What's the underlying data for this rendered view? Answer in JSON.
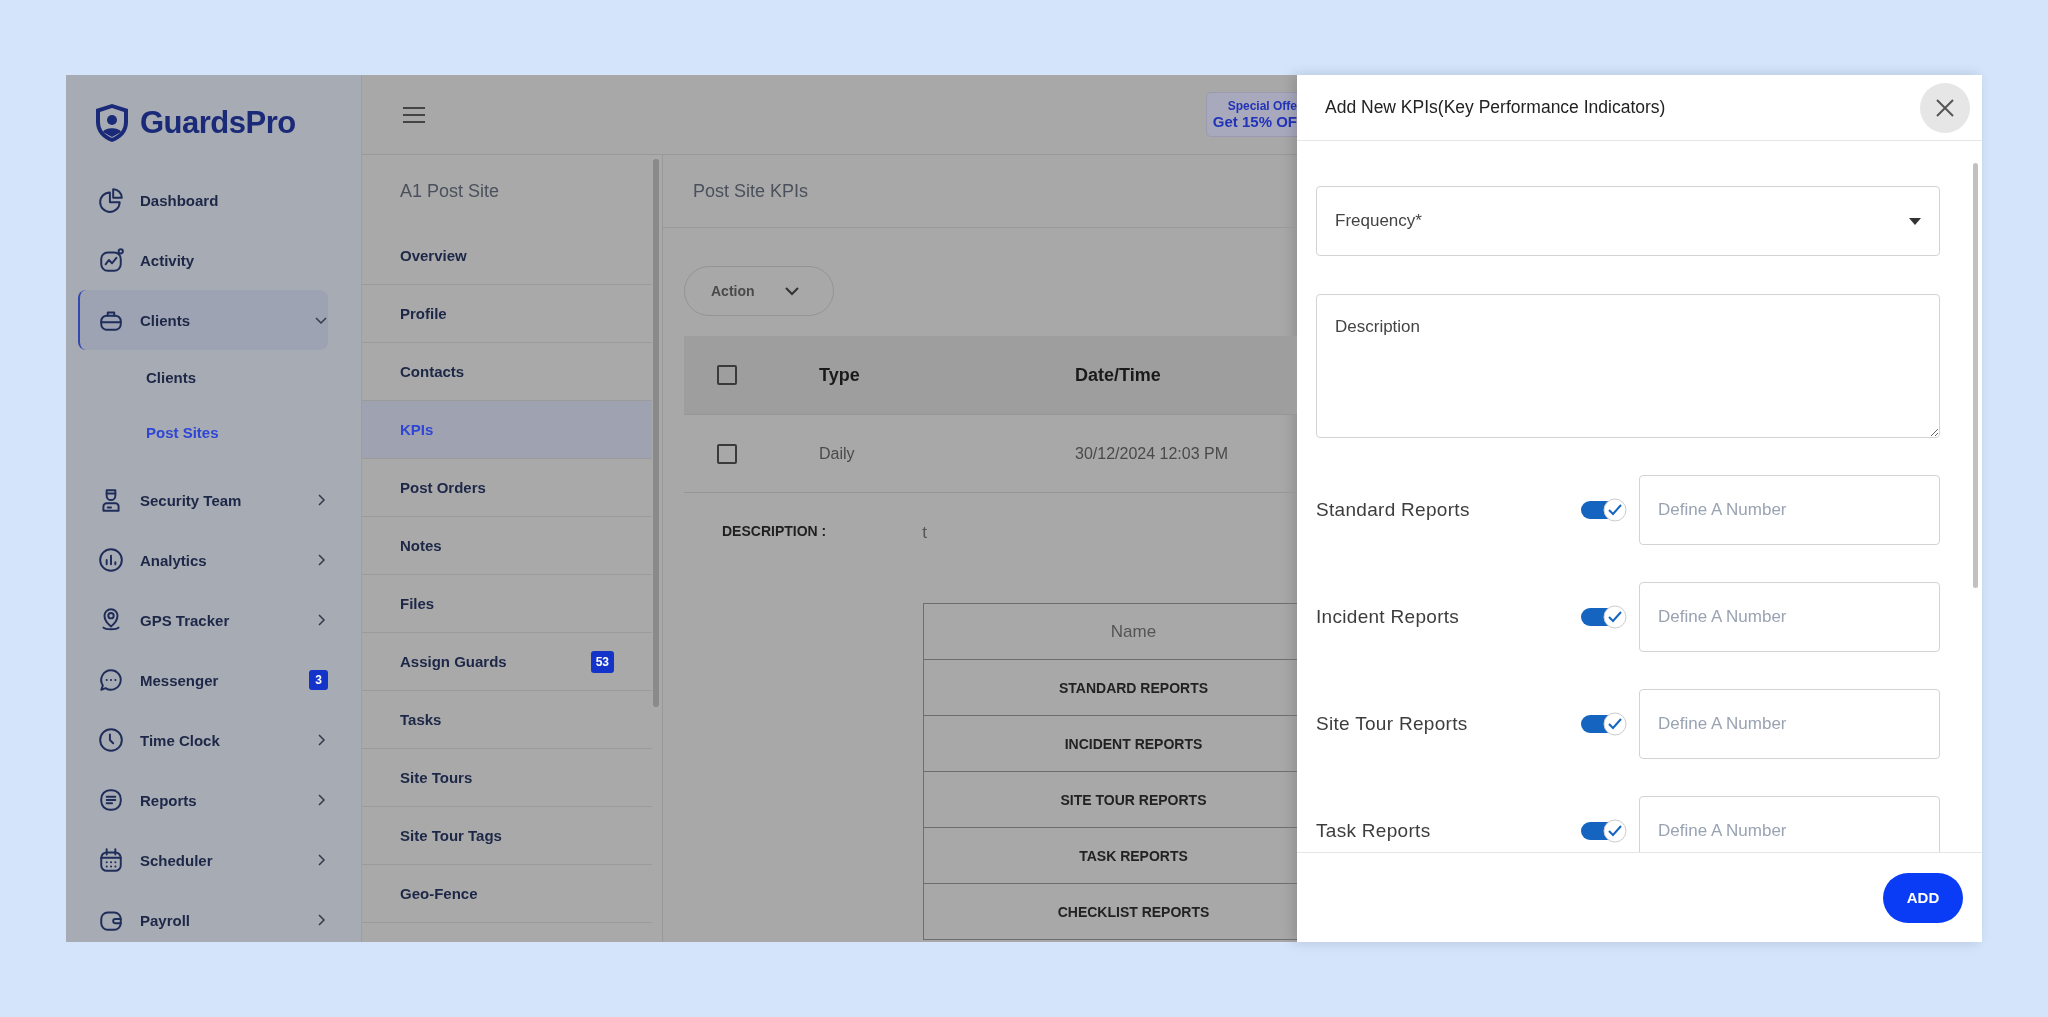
{
  "sidebar": {
    "logo": "GuardsPro",
    "items": [
      {
        "label": "Dashboard",
        "kind": "link",
        "selected": false
      },
      {
        "label": "Activity",
        "kind": "link",
        "selected": false
      },
      {
        "label": "Clients",
        "kind": "group",
        "selected": true,
        "expanded": true,
        "children": [
          {
            "label": "Clients",
            "selected": false
          },
          {
            "label": "Post Sites",
            "selected": true
          }
        ]
      },
      {
        "label": "Security Team",
        "kind": "group",
        "selected": false,
        "expanded": false
      },
      {
        "label": "Analytics",
        "kind": "group",
        "selected": false,
        "expanded": false
      },
      {
        "label": "GPS Tracker",
        "kind": "group",
        "selected": false,
        "expanded": false
      },
      {
        "label": "Messenger",
        "kind": "badge",
        "selected": false,
        "badge": "3"
      },
      {
        "label": "Time Clock",
        "kind": "group",
        "selected": false,
        "expanded": false
      },
      {
        "label": "Reports",
        "kind": "group",
        "selected": false,
        "expanded": false
      },
      {
        "label": "Scheduler",
        "kind": "group",
        "selected": false,
        "expanded": false
      },
      {
        "label": "Payroll",
        "kind": "group",
        "selected": false,
        "expanded": false
      }
    ]
  },
  "promo": {
    "line_1": "Special Offe",
    "line_2": "Get 15% OF"
  },
  "site_nav": {
    "title": "A1 Post Site",
    "items": [
      {
        "label": "Overview",
        "selected": false
      },
      {
        "label": "Profile",
        "selected": false
      },
      {
        "label": "Contacts",
        "selected": false
      },
      {
        "label": "KPIs",
        "selected": true
      },
      {
        "label": "Post Orders",
        "selected": false
      },
      {
        "label": "Notes",
        "selected": false
      },
      {
        "label": "Files",
        "selected": false
      },
      {
        "label": "Assign Guards",
        "selected": false,
        "badge": "53"
      },
      {
        "label": "Tasks",
        "selected": false
      },
      {
        "label": "Site Tours",
        "selected": false
      },
      {
        "label": "Site Tour Tags",
        "selected": false
      },
      {
        "label": "Geo-Fence",
        "selected": false
      }
    ]
  },
  "main": {
    "title": "Post Site KPIs",
    "action_button": "Action",
    "table": {
      "header_checked": false,
      "columns": [
        "Type",
        "Date/Time"
      ],
      "rows": [
        {
          "checked": false,
          "cells": [
            "Daily",
            "30/12/2024 12:03 PM"
          ]
        }
      ]
    },
    "description_label": "DESCRIPTION :",
    "description_value": "t",
    "kpi_table": {
      "column": "Name",
      "rows": [
        "STANDARD REPORTS",
        "INCIDENT REPORTS",
        "SITE TOUR REPORTS",
        "TASK REPORTS",
        "CHECKLIST REPORTS"
      ]
    }
  },
  "modal": {
    "title": "Add New KPIs(Key Performance Indicators)",
    "frequency_label": "Frequency*",
    "description_placeholder": "Description",
    "kpis": [
      {
        "label": "Standard Reports",
        "on": true,
        "placeholder": "Define A Number"
      },
      {
        "label": "Incident Reports",
        "on": true,
        "placeholder": "Define A Number"
      },
      {
        "label": "Site Tour Reports",
        "on": true,
        "placeholder": "Define A Number"
      },
      {
        "label": "Task Reports",
        "on": true,
        "placeholder": "Define A Number"
      }
    ],
    "add_button": "ADD"
  }
}
